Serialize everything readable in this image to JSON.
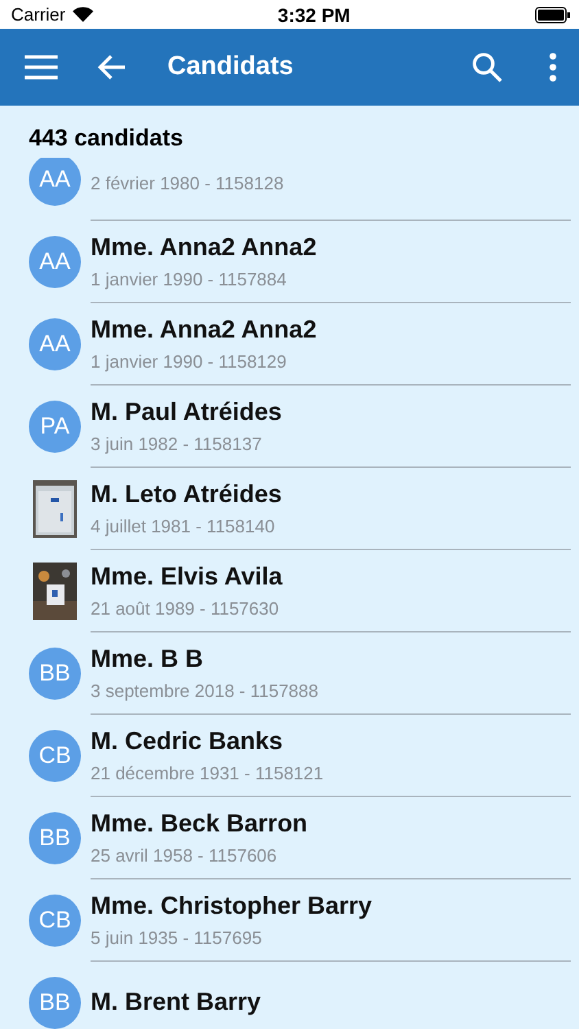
{
  "status_bar": {
    "carrier": "Carrier",
    "time": "3:32 PM"
  },
  "header": {
    "title": "Candidats"
  },
  "count": "443 candidats",
  "rows": [
    {
      "kind": "partial",
      "initials": "AA",
      "subtitle": "2 février 1980 - 1158128"
    },
    {
      "kind": "initials",
      "initials": "AA",
      "name": "Mme. Anna2 Anna2",
      "subtitle": "1 janvier 1990 - 1157884"
    },
    {
      "kind": "initials",
      "initials": "AA",
      "name": "Mme. Anna2 Anna2",
      "subtitle": "1 janvier 1990 - 1158129"
    },
    {
      "kind": "initials",
      "initials": "PA",
      "name": "M. Paul Atréides",
      "subtitle": "3 juin 1982 - 1158137"
    },
    {
      "name": "M. Leto Atréides",
      "subtitle": "4 juillet 1981 - 1158140"
    },
    {
      "name": "Mme. Elvis Avila",
      "subtitle": "21 août 1989 - 1157630"
    },
    {
      "kind": "initials",
      "initials": "BB",
      "name": "Mme. B B",
      "subtitle": "3 septembre 2018 - 1157888"
    },
    {
      "kind": "initials",
      "initials": "CB",
      "name": "M. Cedric Banks",
      "subtitle": "21 décembre 1931 - 1158121"
    },
    {
      "kind": "initials",
      "initials": "BB",
      "name": "Mme. Beck Barron",
      "subtitle": "25 avril 1958 - 1157606"
    },
    {
      "kind": "initials",
      "initials": "CB",
      "name": "Mme. Christopher Barry",
      "subtitle": "5 juin 1935 - 1157695"
    },
    {
      "kind": "initials",
      "initials": "BB",
      "name": "M. Brent Barry"
    }
  ]
}
